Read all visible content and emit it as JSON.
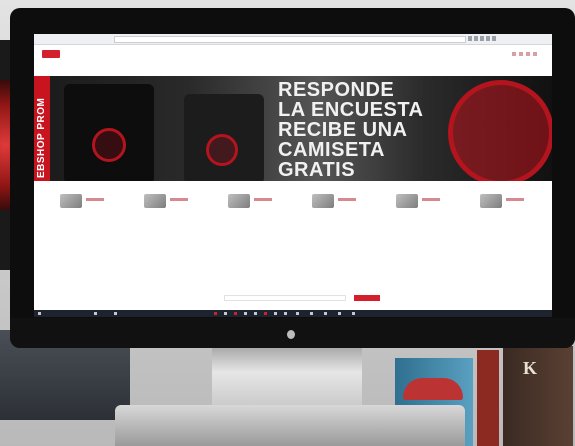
{
  "hero": {
    "side_label": "EBSHOP PROM",
    "lines": [
      "RESPONDE",
      "LA ENCUESTA",
      "RECIBE UNA",
      "CAMISETA",
      "GRATIS"
    ]
  },
  "nav": {
    "items": [
      "",
      "",
      "",
      "",
      "",
      "",
      ""
    ]
  },
  "products": [
    {
      "name": "",
      "price": ""
    },
    {
      "name": "",
      "price": ""
    },
    {
      "name": "",
      "price": ""
    },
    {
      "name": "",
      "price": ""
    },
    {
      "name": "",
      "price": ""
    },
    {
      "name": "",
      "price": ""
    }
  ],
  "colors": {
    "brand_red": "#d41f2d",
    "hero_dark": "#1a1a1a"
  },
  "icons": [
    "apple-logo-icon",
    "browser-toolbar-icons",
    "taskbar-app-icons"
  ]
}
